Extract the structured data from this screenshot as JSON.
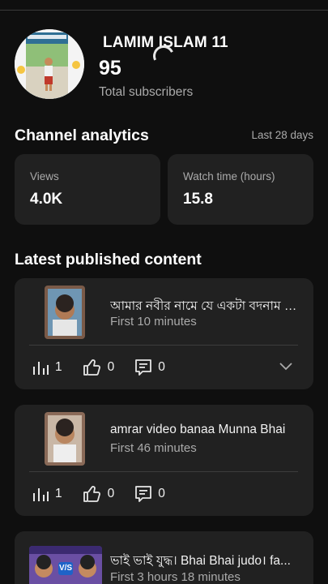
{
  "channel": {
    "name": "LAMIM ISLAM 11",
    "subscriber_count": "95",
    "subscriber_label": "Total subscribers"
  },
  "analytics": {
    "title": "Channel analytics",
    "period": "Last 28 days",
    "views": {
      "label": "Views",
      "value": "4.0K"
    },
    "watch_time": {
      "label": "Watch time (hours)",
      "value": "15.8"
    }
  },
  "latest": {
    "title": "Latest published content",
    "items": [
      {
        "title": "আমার নবীর নামে যে একটা বদনাম দিছে",
        "age": "First 10 minutes",
        "views": "1",
        "likes": "0",
        "comments": "0"
      },
      {
        "title": "amrar video banaa Munna Bhai",
        "age": "First 46 minutes",
        "views": "1",
        "likes": "0",
        "comments": "0"
      },
      {
        "title": "ভাই ভাই যুদ্ধ। Bhai Bhai judo। fa...",
        "age": "First 3 hours 18 minutes",
        "thumb_text": "V/S"
      }
    ]
  },
  "colors": {
    "background": "#0f0f0f",
    "card": "#212121",
    "secondary_text": "#aaaaaa"
  }
}
